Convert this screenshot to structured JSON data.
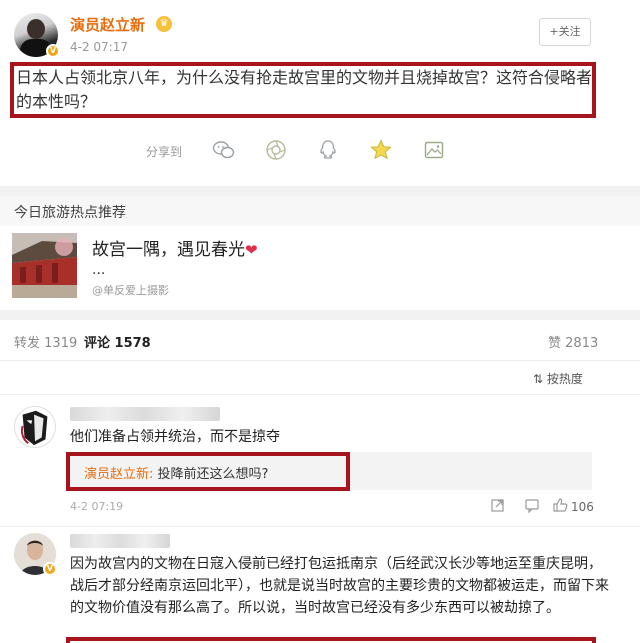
{
  "post": {
    "author": "演员赵立新",
    "time": "4-2 07:17",
    "follow_label": "+关注",
    "text": "日本人占领北京八年，为什么没有抢走故宫里的文物并且烧掉故宫？这符合侵略者的本性吗？",
    "share_label": "分享到",
    "share_icons": [
      "wechat-icon",
      "moments-icon",
      "qq-icon",
      "qzone-icon",
      "image-share-icon"
    ]
  },
  "hot": {
    "section_title": "今日旅游热点推荐",
    "heading": "故宫一隅，遇见春光",
    "heart": "❤",
    "dots": "...",
    "source": "@单反爱上摄影"
  },
  "tabs": {
    "repost_label": "转发",
    "repost_count": "1319",
    "comment_label": "评论",
    "comment_count": "1578",
    "like_label": "赞",
    "like_count": "2813"
  },
  "sort_label": "按热度",
  "comments": [
    {
      "text": "他们准备占领并统治，而不是掠夺",
      "reply_author": "演员赵立新:",
      "reply_text": " 投降前还这么想吗?",
      "time": "4-2 07:19",
      "likes": "106"
    },
    {
      "text": "因为故宫内的文物在日寇入侵前已经打包运抵南京（后经武汉长沙等地运至重庆昆明，战后才部分经南京运回北平），也就是说当时故宫的主要珍贵的文物都被运走，而留下来的文物价值没有那么高了。所以说，当时故宫已经没有多少东西可以被劫掠了。"
    }
  ],
  "colors": {
    "accent": "#e86d0f",
    "highlight_box": "#a8141c"
  }
}
